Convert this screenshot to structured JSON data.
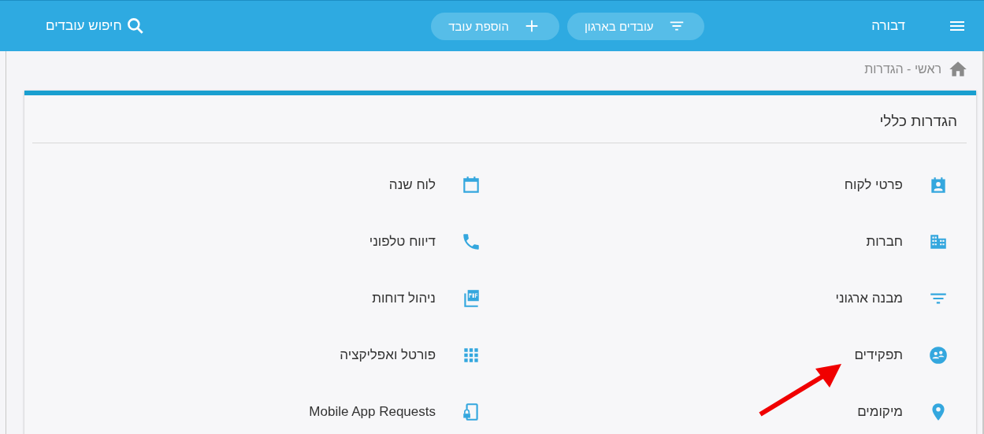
{
  "top_bar": {
    "user_name": "דבורה",
    "buttons": [
      {
        "label": "עובדים בארגון",
        "kind": "filter"
      },
      {
        "label": "הוספת עובד",
        "kind": "add"
      }
    ],
    "search": {
      "label": "חיפוש עובדים"
    }
  },
  "breadcrumb": {
    "text": "ראשי - הגדרות"
  },
  "card": {
    "title": "הגדרות כללי",
    "items": [
      {
        "label": "פרטי לקוח",
        "kind": "contact"
      },
      {
        "label": "לוח שנה",
        "kind": "calendar"
      },
      {
        "label": "חברות",
        "kind": "building"
      },
      {
        "label": "דיווח טלפוני",
        "kind": "phone"
      },
      {
        "label": "מבנה ארגוני",
        "kind": "filter"
      },
      {
        "label": "ניהול דוחות",
        "kind": "pdf"
      },
      {
        "label": "תפקידים",
        "kind": "roles"
      },
      {
        "label": "פורטל ואפליקציה",
        "kind": "apps"
      },
      {
        "label": "מיקומים",
        "kind": "place"
      },
      {
        "label": "Mobile App Requests",
        "kind": "lock-phone"
      }
    ]
  }
}
